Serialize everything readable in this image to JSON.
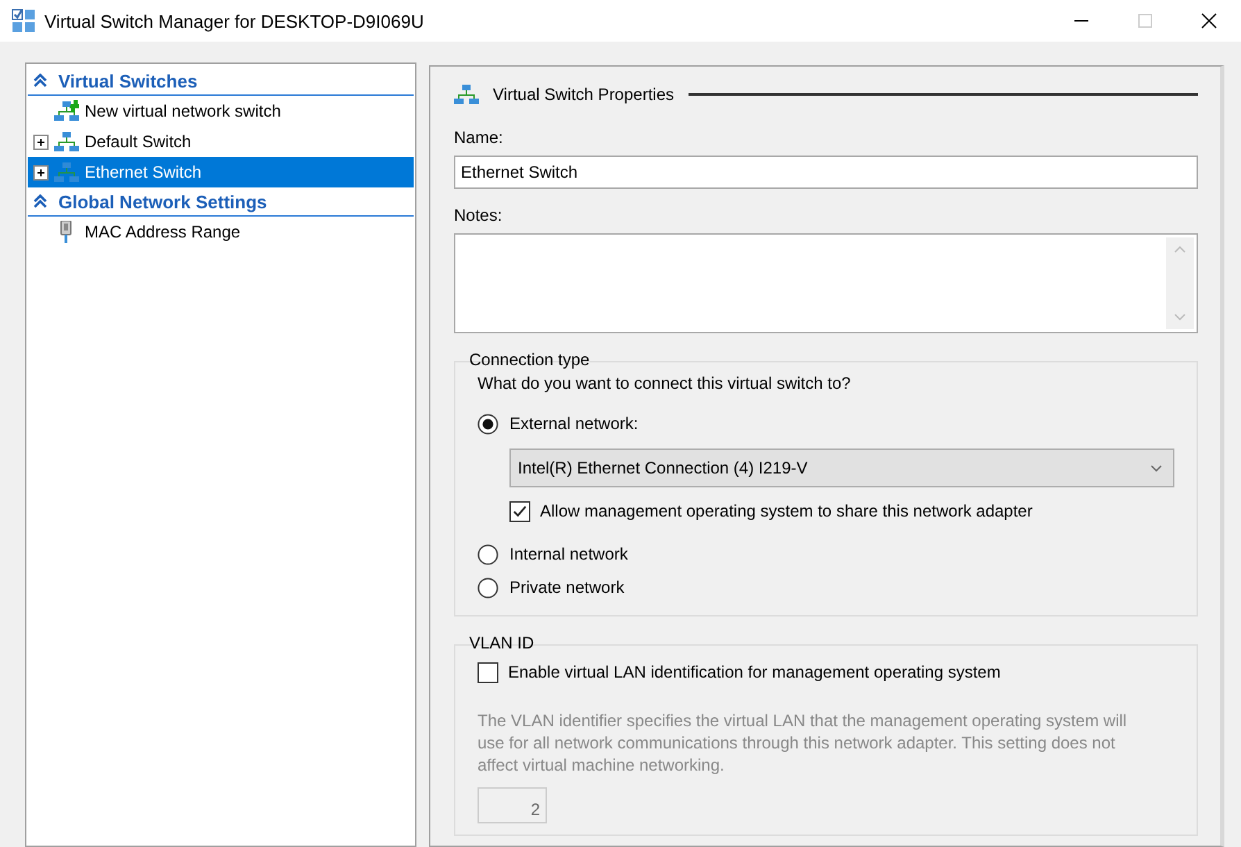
{
  "window": {
    "title": "Virtual Switch Manager for DESKTOP-D9I069U"
  },
  "sidebar": {
    "sections": [
      {
        "title": "Virtual Switches",
        "expanded": true,
        "items": [
          {
            "kind": "new-switch",
            "label": "New virtual network switch",
            "selected": false
          },
          {
            "kind": "switch",
            "label": "Default Switch",
            "selected": false,
            "expanded": false
          },
          {
            "kind": "switch",
            "label": "Ethernet Switch",
            "selected": true,
            "expanded": false
          }
        ]
      },
      {
        "title": "Global Network Settings",
        "expanded": true,
        "items": [
          {
            "kind": "mac",
            "label": "MAC Address Range",
            "selected": false
          }
        ]
      }
    ]
  },
  "properties": {
    "title": "Virtual Switch Properties",
    "name": {
      "label": "Name:",
      "value": "Ethernet Switch"
    },
    "notes": {
      "label": "Notes:"
    },
    "connection_type": {
      "title": "Connection type",
      "question": "What do you want to connect this virtual switch to?",
      "options": [
        {
          "label": "External network:",
          "selected": true,
          "adapter": "Intel(R) Ethernet Connection (4) I219-V",
          "share": {
            "label": "Allow management operating system to share this network adapter",
            "checked": true
          }
        },
        {
          "label": "Internal network",
          "selected": false
        },
        {
          "label": "Private network",
          "selected": false
        }
      ]
    },
    "vlan": {
      "title": "VLAN ID",
      "enable": {
        "label": "Enable virtual LAN identification for management operating system",
        "checked": false
      },
      "description": "The VLAN identifier specifies the virtual LAN that the management operating system will use for all network communications through this network adapter. This setting does not affect virtual machine networking.",
      "value": "2",
      "disabled": true
    }
  }
}
